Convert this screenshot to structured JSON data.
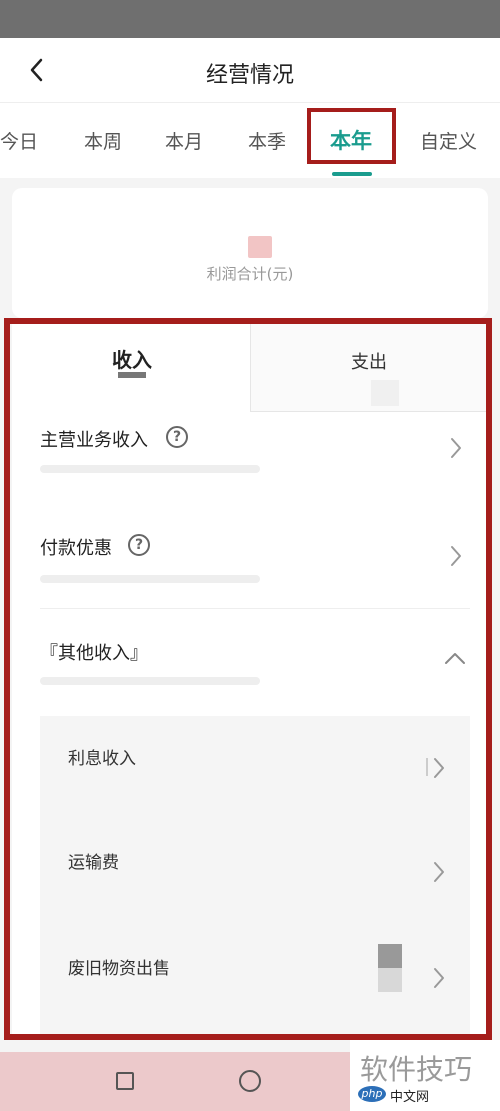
{
  "header": {
    "title": "经营情况"
  },
  "tabs": [
    {
      "label": "今日"
    },
    {
      "label": "本周"
    },
    {
      "label": "本月"
    },
    {
      "label": "本季"
    },
    {
      "label": "本年"
    },
    {
      "label": "自定义"
    }
  ],
  "active_tab": "本年",
  "summary": {
    "label": "利润合计(元)"
  },
  "segments": {
    "income": "收入",
    "expense": "支出"
  },
  "income_items": [
    {
      "label": "主营业务收入",
      "has_help": true
    },
    {
      "label": "付款优惠",
      "has_help": true
    },
    {
      "label": "『其他收入』",
      "expanded": true
    }
  ],
  "other_income_items": [
    {
      "label": "利息收入"
    },
    {
      "label": "运输费"
    },
    {
      "label": "废旧物资出售"
    }
  ],
  "help_glyph": "?",
  "watermark": {
    "main": "软件技巧",
    "logo": "php",
    "sub": "中文网"
  },
  "colors": {
    "accent": "#1a9c8e",
    "highlight_border": "#a51d1b"
  }
}
